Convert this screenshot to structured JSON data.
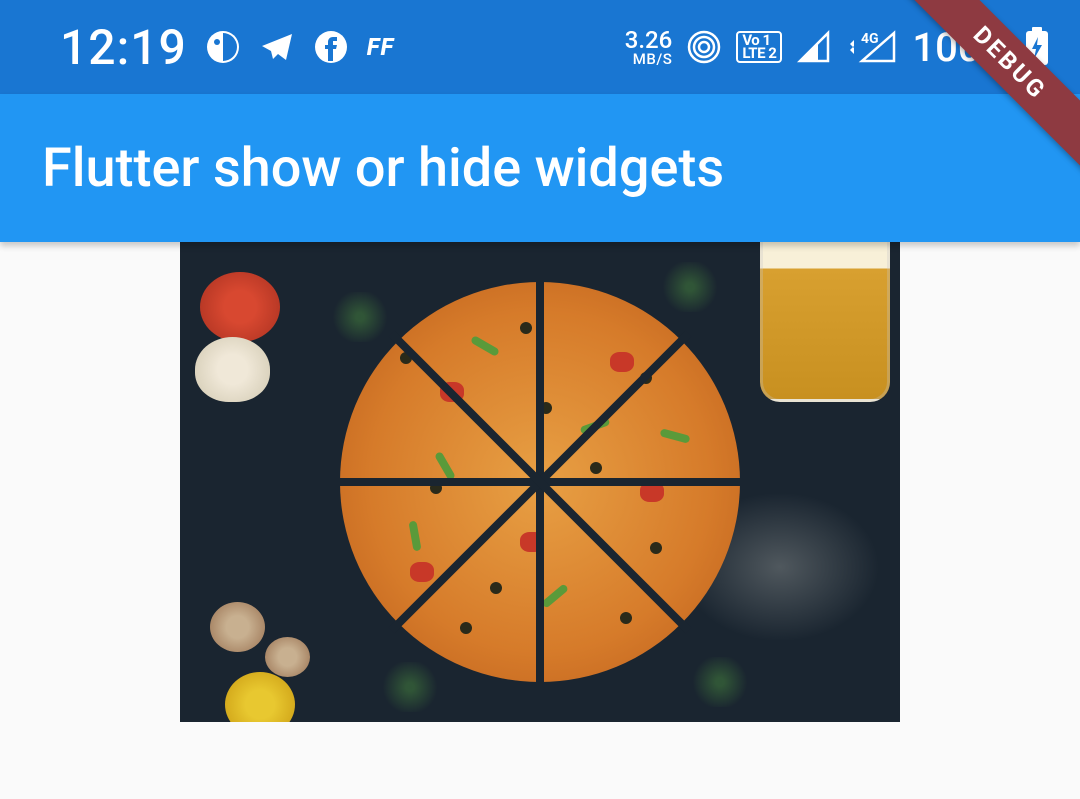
{
  "status_bar": {
    "time": "12:19",
    "ff_label": "FF",
    "net_speed_value": "3.26",
    "net_speed_unit": "MB/S",
    "volte_line1": "Vo 1",
    "volte_line2": "LTE 2",
    "network_label": "4G",
    "battery_pct": "100%"
  },
  "app_bar": {
    "title": "Flutter show or hide widgets"
  },
  "content": {
    "image_description": "Pizza cut into slices on dark surface with vegetables and beer"
  },
  "debug_banner": {
    "label": "DEBUG"
  },
  "colors": {
    "status_bar_bg": "#1976d2",
    "app_bar_bg": "#2196f3",
    "debug_ribbon": "#8e3a41"
  }
}
